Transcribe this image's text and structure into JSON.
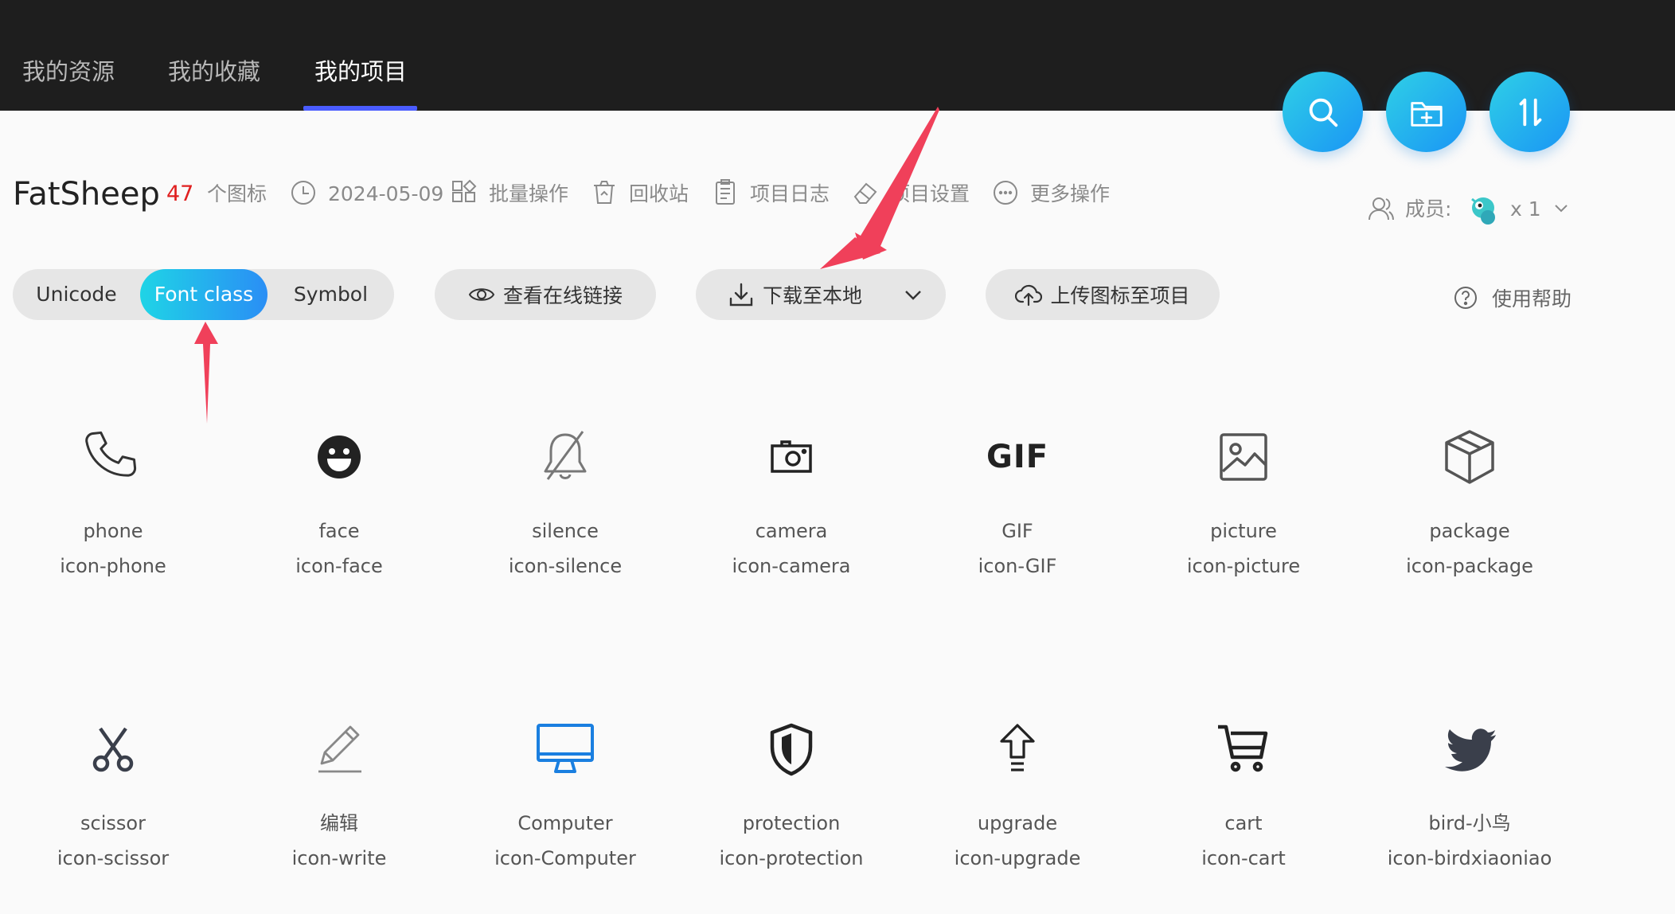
{
  "nav": {
    "tabs": [
      {
        "label": "我的资源",
        "active": false
      },
      {
        "label": "我的收藏",
        "active": false
      },
      {
        "label": "我的项目",
        "active": true
      }
    ]
  },
  "fab_buttons": [
    {
      "icon": "search-icon"
    },
    {
      "icon": "new-folder-icon"
    },
    {
      "icon": "sort-icon"
    }
  ],
  "project": {
    "name": "FatSheep",
    "icon_count": "47",
    "icon_count_suffix": "个图标",
    "date": "2024-05-09",
    "actions": {
      "batch": "批量操作",
      "recycle": "回收站",
      "log": "项目日志",
      "settings": "项目设置",
      "more": "更多操作"
    },
    "members_label": "成员:",
    "member_count": "x 1"
  },
  "toolbar": {
    "formats": [
      "Unicode",
      "Font class",
      "Symbol"
    ],
    "active_format": "Font class",
    "view_online_link": "查看在线链接",
    "download": "下载至本地",
    "upload": "上传图标至项目",
    "help": "使用帮助"
  },
  "icons": [
    {
      "name": "phone",
      "class": "icon-phone",
      "glyph": "phone-icon"
    },
    {
      "name": "face",
      "class": "icon-face",
      "glyph": "face-icon"
    },
    {
      "name": "silence",
      "class": "icon-silence",
      "glyph": "bell-off-icon"
    },
    {
      "name": "camera",
      "class": "icon-camera",
      "glyph": "camera-icon"
    },
    {
      "name": "GIF",
      "class": "icon-GIF",
      "glyph": "gif-icon",
      "glyph_text": "GIF"
    },
    {
      "name": "picture",
      "class": "icon-picture",
      "glyph": "picture-icon"
    },
    {
      "name": "package",
      "class": "icon-package",
      "glyph": "package-icon"
    },
    {
      "name": "scissor",
      "class": "icon-scissor",
      "glyph": "scissor-icon"
    },
    {
      "name": "编辑",
      "class": "icon-write",
      "glyph": "pencil-icon"
    },
    {
      "name": "Computer",
      "class": "icon-Computer",
      "glyph": "computer-icon"
    },
    {
      "name": "protection",
      "class": "icon-protection",
      "glyph": "shield-icon"
    },
    {
      "name": "upgrade",
      "class": "icon-upgrade",
      "glyph": "upgrade-arrow-icon"
    },
    {
      "name": "cart",
      "class": "icon-cart",
      "glyph": "cart-icon"
    },
    {
      "name": "bird-小鸟",
      "class": "icon-birdxiaoniao",
      "glyph": "bird-icon"
    }
  ],
  "colors": {
    "topbar": "#1e1e1e",
    "accent_gradient_start": "#1fd4e6",
    "accent_gradient_end": "#2a8ef5",
    "tab_underline": "#4a5cff",
    "count_red": "#e02020",
    "annotation_arrow": "#f0405a",
    "computer_icon": "#1a7fe0"
  }
}
